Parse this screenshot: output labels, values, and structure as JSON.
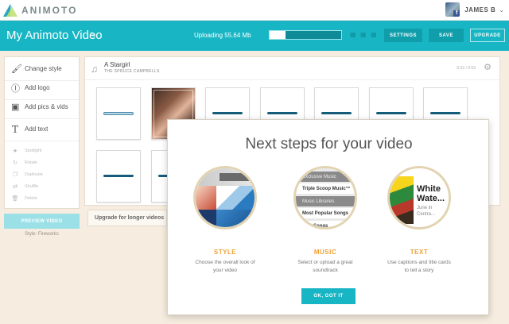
{
  "app": {
    "brand": "ANIMOTO"
  },
  "user": {
    "name": "JAMES B"
  },
  "header": {
    "title": "My Animoto Video",
    "upload_label": "Uploading 55.64 Mb",
    "upload_progress": 0.22,
    "settings_label": "SETTINGS",
    "save_label": "SAVE",
    "upgrade_label": "UPGRADE"
  },
  "left_panel": {
    "items": [
      {
        "label": "Change style",
        "icon": "brush-icon"
      },
      {
        "label": "Add logo",
        "icon": "logo-icon"
      },
      {
        "label": "Add pics & vids",
        "icon": "photos-icon"
      },
      {
        "label": "Add text",
        "icon": "text-icon"
      }
    ],
    "sub_items": [
      {
        "label": "Spotlight",
        "icon": "star-icon"
      },
      {
        "label": "Rotate",
        "icon": "rotate-icon"
      },
      {
        "label": "Duplicate",
        "icon": "duplicate-icon"
      },
      {
        "label": "Shuffle",
        "icon": "shuffle-icon"
      },
      {
        "label": "Delete",
        "icon": "trash-icon"
      }
    ],
    "preview_label": "PREVIEW VIDEO",
    "style_name": "Style: Fireworks"
  },
  "song": {
    "title": "A Stargirl",
    "artist": "THE SPRUCE CAMPBELLS",
    "time": "0:22 / 0:53"
  },
  "upgrade_text": "Upgrade for longer videos",
  "modal": {
    "title": "Next steps for your video",
    "steps": [
      {
        "heading": "STYLE",
        "desc_line1": "Choose the overall look of",
        "desc_line2": "your video"
      },
      {
        "heading": "MUSIC",
        "desc_line1": "Select or upload a great",
        "desc_line2": "soundtrack"
      },
      {
        "heading": "TEXT",
        "desc_line1": "Use captions and title cards",
        "desc_line2": "to tell a story"
      }
    ],
    "music_list": [
      "Exclusive Music",
      "Triple Scoop Music™",
      "Music Libraries",
      "Most Popular Songs",
      "New Songs"
    ],
    "text_sample": {
      "big1": "White",
      "big2": "Wate...",
      "small1": "June in",
      "small2": "Centra..."
    },
    "ok_label": "OK, GOT IT"
  },
  "colors": {
    "accent": "#18b6c4",
    "highlight": "#f0a033",
    "background": "#f6ecdf"
  }
}
